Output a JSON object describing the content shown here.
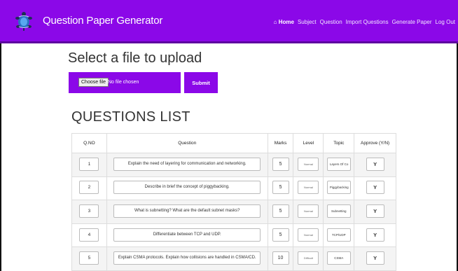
{
  "navbar": {
    "brand": "Question Paper Generator",
    "colors": {
      "background": "#8b08e8"
    },
    "logo_icon": "turtle-logo-icon",
    "items": [
      {
        "label": "Home",
        "icon": "home-icon",
        "active": true
      },
      {
        "label": "Subject"
      },
      {
        "label": "Question"
      },
      {
        "label": "Import Questions"
      },
      {
        "label": "Generate Paper"
      },
      {
        "label": "Log Out"
      }
    ]
  },
  "upload": {
    "title": "Select a file to upload",
    "choose_label": "Choose file",
    "no_file_text": "No file chosen",
    "submit_label": "Submit"
  },
  "questions": {
    "title": "QUESTIONS LIST",
    "headers": [
      "Q.NO",
      "Question",
      "Marks",
      "Level",
      "Topic",
      "Approve (Y/N)"
    ],
    "rows": [
      {
        "no": "1",
        "question": "Explain the need of layering for communication and networking.",
        "marks": "5",
        "level": "Normal",
        "topic": "Layers Of Co",
        "approve": "Y"
      },
      {
        "no": "2",
        "question": "Describe in brief the concept of piggybacking.",
        "marks": "5",
        "level": "Normal",
        "topic": "Piggybacking",
        "approve": "Y"
      },
      {
        "no": "3",
        "question": "What is subnetting? What are the default subnet masks?",
        "marks": "5",
        "level": "Normal",
        "topic": "Subnetting",
        "approve": "Y"
      },
      {
        "no": "4",
        "question": "Differentiate between TCP and UDP.",
        "marks": "5",
        "level": "Normal",
        "topic": "TCP/UDP",
        "approve": "Y"
      },
      {
        "no": "5",
        "question": "Explain CSMA protocols. Explain how collisions are handled in CSMA/CD.",
        "marks": "10",
        "level": "Difficult",
        "topic": "CSMA",
        "approve": "Y"
      }
    ]
  }
}
